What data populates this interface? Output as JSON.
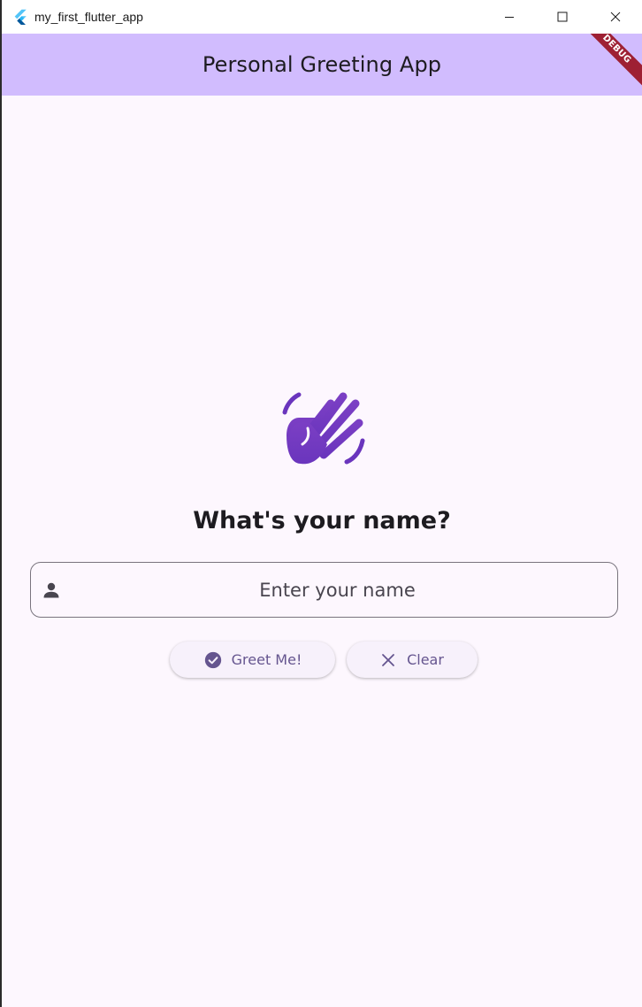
{
  "window": {
    "title": "my_first_flutter_app",
    "controls": [
      "minimize",
      "maximize",
      "close"
    ]
  },
  "appbar": {
    "title": "Personal Greeting App",
    "debug_banner": "DEBUG",
    "color": "#d1bcfe"
  },
  "main": {
    "hero_icon": "waving-hand-icon",
    "prompt": "What's your name?",
    "name_field": {
      "placeholder": "Enter your name",
      "value": "",
      "icon": "person-icon"
    },
    "buttons": {
      "greet": {
        "label": "Greet Me!",
        "icon": "check-circle-icon"
      },
      "clear": {
        "label": "Clear",
        "icon": "close-icon"
      }
    }
  },
  "colors": {
    "primary": "#673ab7",
    "background": "#fdf7fe",
    "button_text": "#65558f",
    "debug": "#9e2033"
  }
}
